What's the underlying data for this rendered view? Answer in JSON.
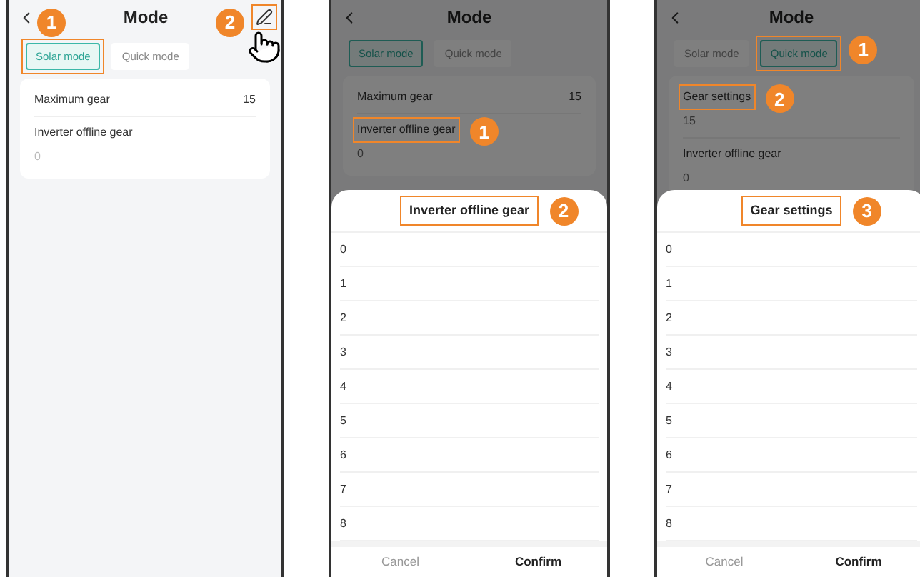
{
  "screens": [
    {
      "title": "Mode",
      "dimmed": false,
      "edit_button": {
        "callout": "2"
      },
      "tabs": [
        {
          "label": "Solar mode",
          "selected": true,
          "callout": "1"
        },
        {
          "label": "Quick mode",
          "selected": false
        }
      ],
      "fields": [
        {
          "kind": "inline",
          "label": "Maximum gear",
          "value": "15"
        },
        {
          "kind": "stacked",
          "label": "Inverter offline gear",
          "value": "0"
        }
      ]
    },
    {
      "title": "Mode",
      "dimmed": true,
      "tabs": [
        {
          "label": "Solar mode",
          "selected": true
        },
        {
          "label": "Quick mode",
          "selected": false
        }
      ],
      "fields": [
        {
          "kind": "inline",
          "label": "Maximum gear",
          "value": "15"
        },
        {
          "kind": "stacked",
          "label": "Inverter offline gear",
          "value": "0",
          "callout": "1"
        }
      ],
      "sheet": {
        "title": "Inverter offline gear",
        "callout": "2",
        "options": [
          "0",
          "1",
          "2",
          "3",
          "4",
          "5",
          "6",
          "7",
          "8"
        ],
        "cancel": "Cancel",
        "confirm": "Confirm"
      }
    },
    {
      "title": "Mode",
      "dimmed": true,
      "tabs": [
        {
          "label": "Solar mode",
          "selected": false
        },
        {
          "label": "Quick mode",
          "selected": true,
          "callout": "1"
        }
      ],
      "fields": [
        {
          "kind": "stacked",
          "label": "Gear settings",
          "value": "15",
          "callout": "2"
        },
        {
          "kind": "stacked",
          "label": "Inverter offline gear",
          "value": "0"
        }
      ],
      "sheet": {
        "title": "Gear settings",
        "callout": "3",
        "options": [
          "0",
          "1",
          "2",
          "3",
          "4",
          "5",
          "6",
          "7",
          "8"
        ],
        "cancel": "Cancel",
        "confirm": "Confirm"
      }
    }
  ]
}
